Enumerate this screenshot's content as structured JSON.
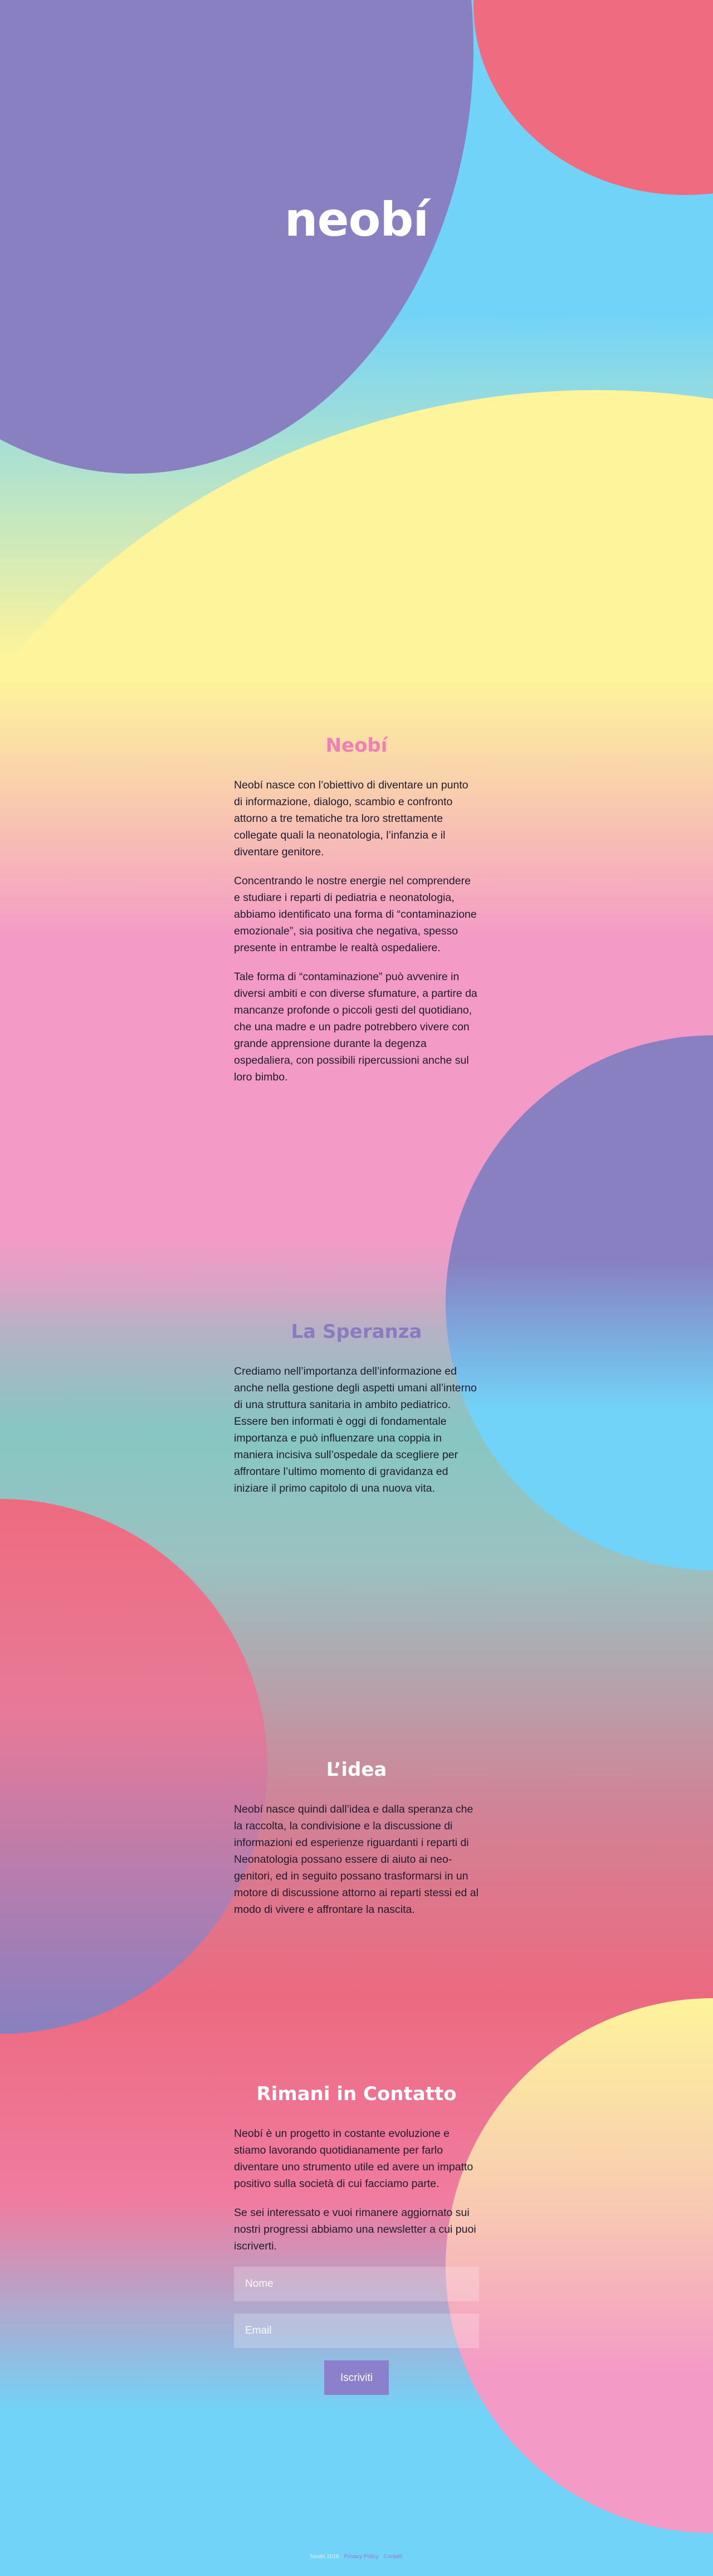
{
  "brand": {
    "logo_text": "neobí"
  },
  "sections": {
    "neobi": {
      "title": "Neobí",
      "paragraphs": [
        "Neobí nasce con l’obiettivo di diventare un punto di informazione, dialogo, scambio e confronto attorno a tre tematiche tra loro strettamente collegate quali la neonatologia, l’infanzia e il diventare genitore.",
        "Concentrando le nostre energie nel comprendere e studiare i reparti di pediatria e neonatologia, abbiamo identificato una forma di “contaminazione emozionale”, sia positiva che negativa, spesso presente in entrambe le realtà ospedaliere.",
        "Tale forma di “contaminazione” può avvenire in diversi ambiti e con diverse sfumature, a partire da mancanze profonde o piccoli gesti del quotidiano, che una madre e un padre potrebbero vivere con grande apprensione durante la degenza ospedaliera, con possibili ripercussioni anche sul loro bimbo."
      ]
    },
    "speranza": {
      "title": "La Speranza",
      "paragraphs": [
        "Crediamo nell’importanza dell’informazione ed anche nella gestione degli aspetti umani all’interno di una struttura sanitaria in ambito pediatrico. Essere ben informati è oggi di fondamentale importanza e può influenzare una coppia in maniera incisiva sull’ospedale da scegliere per affrontare l’ultimo momento di gravidanza ed iniziare il primo capitolo di una nuova vita."
      ]
    },
    "idea": {
      "title": "L’idea",
      "paragraphs": [
        "Neobí nasce quindi dall’idea e dalla speranza che la raccolta, la condivisione e la discussione di informazioni ed esperienze riguardanti i reparti di Neonatologia possano essere di aiuto ai neo-genitori, ed in seguito possano trasformarsi in un motore di discussione attorno ai reparti stessi ed al modo di vivere e affrontare la nascita."
      ]
    },
    "contatto": {
      "title": "Rimani in Contatto",
      "paragraphs": [
        "Neobí  è un progetto in costante evoluzione e stiamo lavorando quotidianamente per farlo diventare uno strumento utile ed avere un impatto positivo sulla società di cui facciamo parte.",
        "Se sei interessato e vuoi rimanere aggiornato sui nostri progressi abbiamo una newsletter a cui puoi iscriverti."
      ]
    }
  },
  "newsletter": {
    "name_placeholder": "Nome",
    "email_placeholder": "Email",
    "submit_label": "Iscriviti"
  },
  "footer": {
    "prefix": "Neobí 2016 · ",
    "link_1": "Privacy Policy",
    "middle": " · ",
    "link_2": "Contatti"
  },
  "colors": {
    "sky_blue": "#72d3f8",
    "purple": "#8c80cc",
    "coral": "#ef6b7f",
    "yellow": "#fdf49b",
    "pink": "#f49ac6",
    "teal": "#76cac4"
  }
}
